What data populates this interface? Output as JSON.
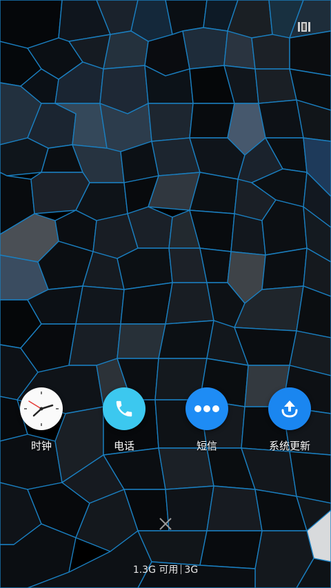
{
  "apps": [
    {
      "label": "时钟",
      "icon": "clock-icon"
    },
    {
      "label": "电话",
      "icon": "phone-icon",
      "color": "#3cc8ef"
    },
    {
      "label": "短信",
      "icon": "message-dots-icon",
      "color": "#1e8cf5"
    },
    {
      "label": "系统更新",
      "icon": "upload-icon",
      "color": "#1a86f0"
    }
  ],
  "memory": {
    "available": "1.3G 可用",
    "total": "3G"
  },
  "colors": {
    "wallpaper_line": "#1a7fc0",
    "background": "#000000"
  }
}
